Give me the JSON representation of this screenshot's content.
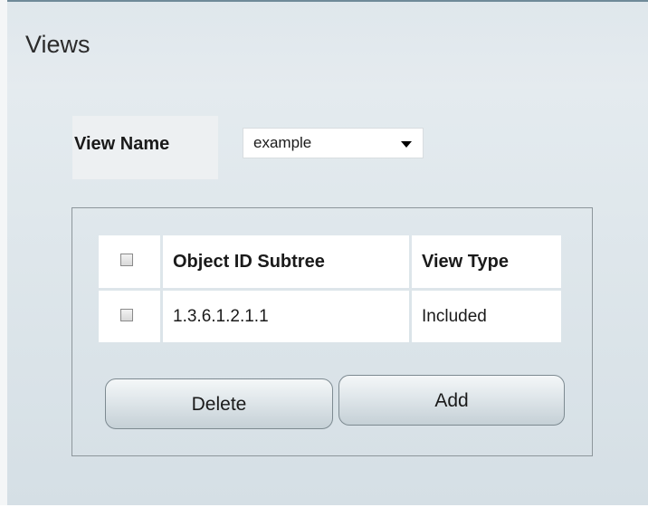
{
  "page": {
    "title": "Views"
  },
  "view_name": {
    "label": "View Name",
    "selected": "example"
  },
  "table": {
    "headers": {
      "object_id_subtree": "Object ID Subtree",
      "view_type": "View Type"
    },
    "rows": [
      {
        "object_id_subtree": "1.3.6.1.2.1.1",
        "view_type": "Included"
      }
    ]
  },
  "buttons": {
    "delete": "Delete",
    "add": "Add"
  }
}
